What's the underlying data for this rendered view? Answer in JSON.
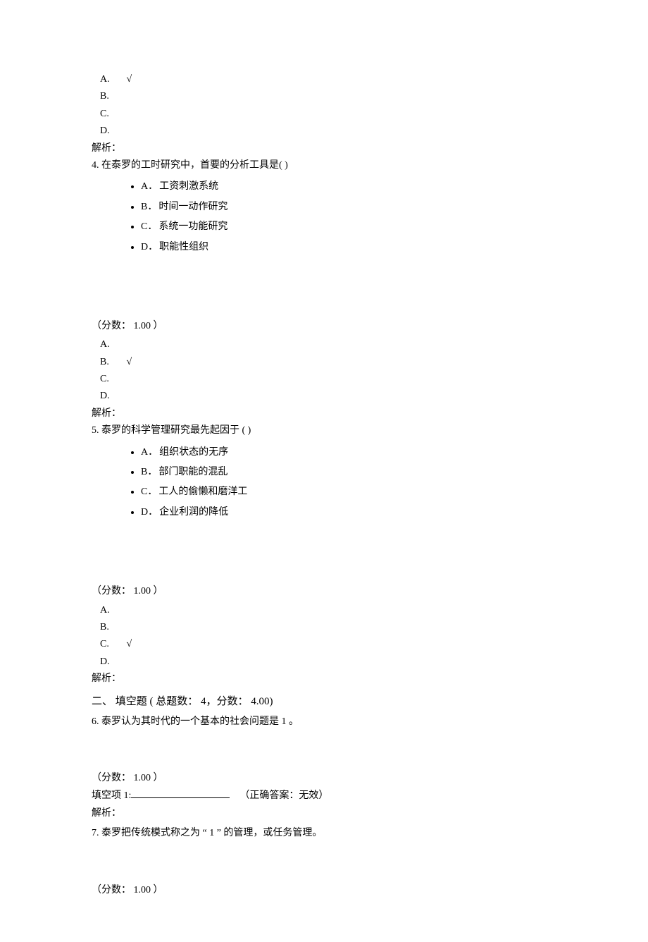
{
  "q3_tail": {
    "answers": [
      {
        "letter": "A.",
        "mark": "√"
      },
      {
        "letter": "B.",
        "mark": ""
      },
      {
        "letter": "C.",
        "mark": ""
      },
      {
        "letter": "D.",
        "mark": ""
      }
    ],
    "analysis_label": "解析："
  },
  "q4": {
    "text": "4. 在泰罗的工时研究中，首要的分析工具是( )",
    "options": [
      {
        "letter": "A．",
        "text": "工资刺激系统"
      },
      {
        "letter": "B．",
        "text": "时间一动作研究"
      },
      {
        "letter": "C．",
        "text": "系统一功能研究"
      },
      {
        "letter": "D．",
        "text": "职能性组织"
      }
    ],
    "score": "（分数： 1.00 ）",
    "answers": [
      {
        "letter": "A.",
        "mark": ""
      },
      {
        "letter": "B.",
        "mark": "√"
      },
      {
        "letter": "C.",
        "mark": ""
      },
      {
        "letter": "D.",
        "mark": ""
      }
    ],
    "analysis_label": "解析："
  },
  "q5": {
    "text": "5. 泰罗的科学管理研究最先起因于   ( )",
    "options": [
      {
        "letter": "A．",
        "text": "组织状态的无序"
      },
      {
        "letter": "B．",
        "text": "部门职能的混乱"
      },
      {
        "letter": "C．",
        "text": "工人的偷懒和磨洋工"
      },
      {
        "letter": "D．",
        "text": "企业利润的降低"
      }
    ],
    "score": "（分数： 1.00 ）",
    "answers": [
      {
        "letter": "A.",
        "mark": ""
      },
      {
        "letter": "B.",
        "mark": ""
      },
      {
        "letter": "C.",
        "mark": "√"
      },
      {
        "letter": "D.",
        "mark": ""
      }
    ],
    "analysis_label": "解析："
  },
  "section2": {
    "header": "二、 填空题 ( 总题数： 4，分数： 4.00)"
  },
  "q6": {
    "text": "6. 泰罗认为其时代的一个基本的社会问题是      1 。",
    "score": "（分数： 1.00 ）",
    "fill_label": "填空项 1:",
    "correct": "（正确答案：无效）",
    "analysis_label": "解析："
  },
  "q7": {
    "text": "7. 泰罗把传统模式称之为 “   1 ” 的管理，或任务管理。",
    "score": "（分数： 1.00 ）"
  }
}
